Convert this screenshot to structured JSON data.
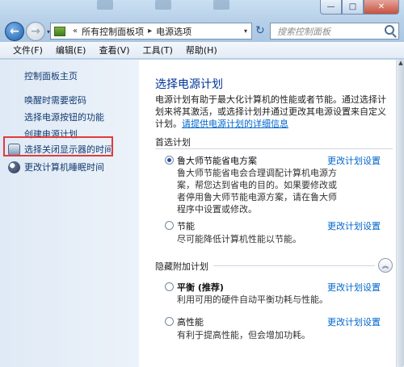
{
  "window": {
    "min_label": "—",
    "max_label": "□",
    "close_label": "✕"
  },
  "address": {
    "sep1": "«",
    "crumb1": "所有控制面板项",
    "sep2": "▸",
    "crumb2": "电源选项",
    "dropdown": "▾"
  },
  "search": {
    "placeholder": "搜索控制面板"
  },
  "menu": [
    "文件(F)",
    "编辑(E)",
    "查看(V)",
    "工具(T)",
    "帮助(H)"
  ],
  "sidebar": {
    "home": "控制面板主页",
    "links": [
      "唤醒时需要密码",
      "选择电源按钮的功能",
      "创建电源计划"
    ],
    "display_off": "选择关闭显示器的时间",
    "sleep": "更改计算机睡眠时间"
  },
  "main": {
    "title": "选择电源计划",
    "description": "电源计划有助于最大化计算机的性能或者节能。通过选择计划来将其激活，或选择计划并通过更改其电源设置来自定义计划。",
    "more_link": "请提供电源计划的详细信息",
    "preferred_header": "首选计划",
    "hidden_header": "隐藏附加计划",
    "collapse_icon": "︽",
    "plans": [
      {
        "name": "鲁大师节能省电方案",
        "bold": false,
        "selected": true,
        "desc": "鲁大师节能省电会合理调配计算机电源方案，帮您达到省电的目的。如果要修改或者停用鲁大师节能电源方案，请在鲁大师程序中设置或修改。",
        "link": "更改计划设置"
      },
      {
        "name": "节能",
        "bold": false,
        "selected": false,
        "desc": "尽可能降低计算机性能以节能。",
        "link": "更改计划设置"
      },
      {
        "name": "平衡 (推荐)",
        "bold": true,
        "selected": false,
        "desc": "利用可用的硬件自动平衡功耗与性能。",
        "link": "更改计划设置"
      },
      {
        "name": "高性能",
        "bold": false,
        "selected": false,
        "desc": "有利于提高性能，但会增加功耗。",
        "link": "更改计划设置"
      }
    ]
  }
}
